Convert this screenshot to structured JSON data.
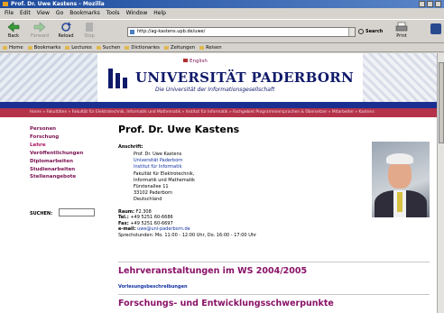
{
  "window": {
    "title": "Prof. Dr. Uwe Kastens - Mozilla"
  },
  "menu": [
    "File",
    "Edit",
    "View",
    "Go",
    "Bookmarks",
    "Tools",
    "Window",
    "Help"
  ],
  "nav": {
    "back": "Back",
    "forward": "Forward",
    "reload": "Reload",
    "stop": "Stop",
    "url": "http://ag-kastens.upb.de/uwe/",
    "search": "Search",
    "print": "Print"
  },
  "bookmarks": [
    "Home",
    "Bookmarks",
    "Lectures",
    "Suchen",
    "Dictionaries",
    "Zeitungen",
    "Reisen"
  ],
  "header": {
    "lang": "English",
    "uni_name": "UNIVERSITÄT PADERBORN",
    "uni_tag": "Die Universität der Informationsgesellschaft"
  },
  "breadcrumb": "Home » Fakultäten » Fakultät für Elektrotechnik, Informatik und Mathematik » Institut für Informatik » Fachgebiet Programmiersprachen & Übersetzer » Mitarbeiter » Kastens",
  "sidebar": {
    "items": [
      "Personen",
      "Forschung",
      "Lehre",
      "Veröffentlichungen",
      "Diplomarbeiten",
      "Studienarbeiten",
      "Stellenangebote"
    ],
    "search_label": "SUCHEN:"
  },
  "profile": {
    "name": "Prof. Dr. Uwe Kastens",
    "address_label": "Anschrift:",
    "address": [
      "Prof. Dr. Uwe Kastens",
      "Universität Paderborn",
      "Institut für Informatik",
      "Fakultät für Elektrotechnik,",
      "Informatik und Mathematik",
      "Fürstenallee 11",
      "33102 Paderborn",
      "Deutschland"
    ],
    "room_label": "Raum:",
    "room": "F2.308",
    "tel_label": "Tel.:",
    "tel": "+49 5251 60-6686",
    "fax_label": "Fax:",
    "fax": "+49 5251 60-6697",
    "email_label": "e-mail:",
    "email": "uwe@uni-paderborn.de",
    "hours": "Sprechstunden: Mo. 11:00 - 12:00 Uhr, Do. 16:00 - 17:00 Uhr"
  },
  "sections": {
    "lectures_title": "Lehrveranstaltungen im WS 2004/2005",
    "lectures_link": "Vorlesungsbeschreibungen",
    "research_title": "Forschungs- und Entwicklungsschwerpunkte"
  }
}
